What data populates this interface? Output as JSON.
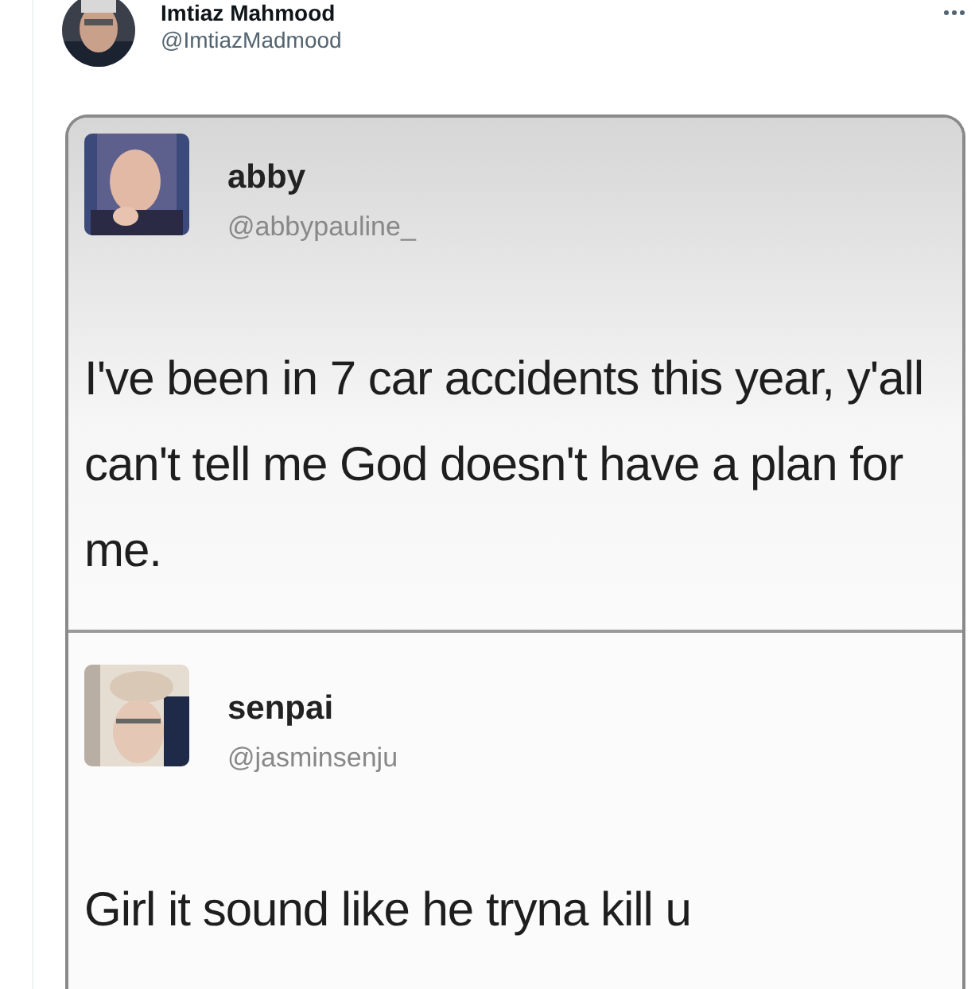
{
  "post": {
    "author": {
      "name": "Imtiaz Mahmood",
      "handle": "@ImtiazMadmood"
    },
    "embedded_tweets": [
      {
        "name": "abby",
        "handle": "@abbypauline_",
        "text": "I've been in 7 car accidents this year, y'all can't tell me God doesn't have a plan for me.",
        "kind": "shaded"
      },
      {
        "name": "senpai",
        "handle": "@jasminsenju",
        "text": "Girl it sound like he tryna kill u",
        "kind": "plain"
      }
    ]
  }
}
